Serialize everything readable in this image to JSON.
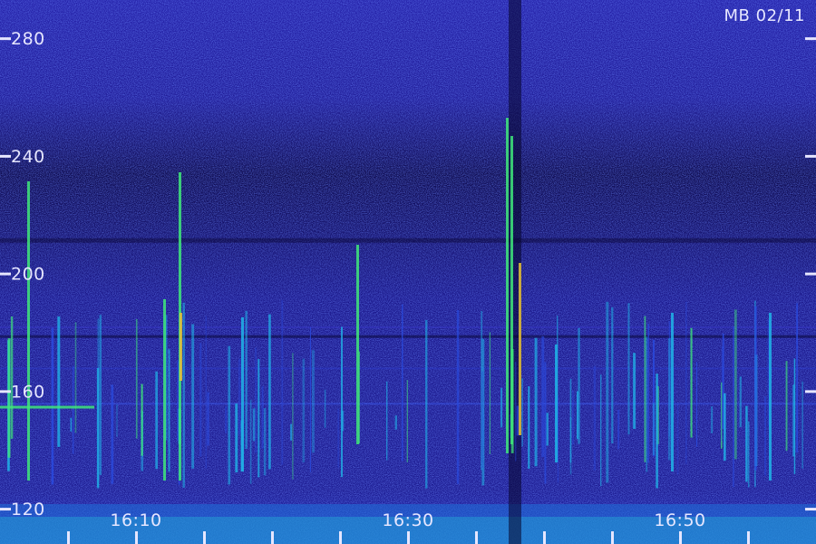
{
  "chart_data": {
    "type": "heatmap",
    "title": "MB 02/11",
    "y_ticks": [
      "120",
      "160",
      "200",
      "240",
      "280"
    ],
    "y_range": [
      108,
      293
    ],
    "x_ticks": [
      "16:10",
      "16:30",
      "16:50"
    ],
    "x_range_minutes": [
      0,
      60
    ],
    "x_minor_tick_minutes": [
      5,
      10,
      15,
      20,
      25,
      30,
      35,
      40,
      45,
      50,
      55
    ],
    "colors": {
      "background": "#1c1a8c",
      "dark_band": "#0c0845",
      "signal_low": "#2a4be0",
      "signal_mid": "#20b4e8",
      "signal_high": "#3fe87a",
      "signal_peak": "#e8c23a",
      "text": "#e6e6ff"
    }
  }
}
